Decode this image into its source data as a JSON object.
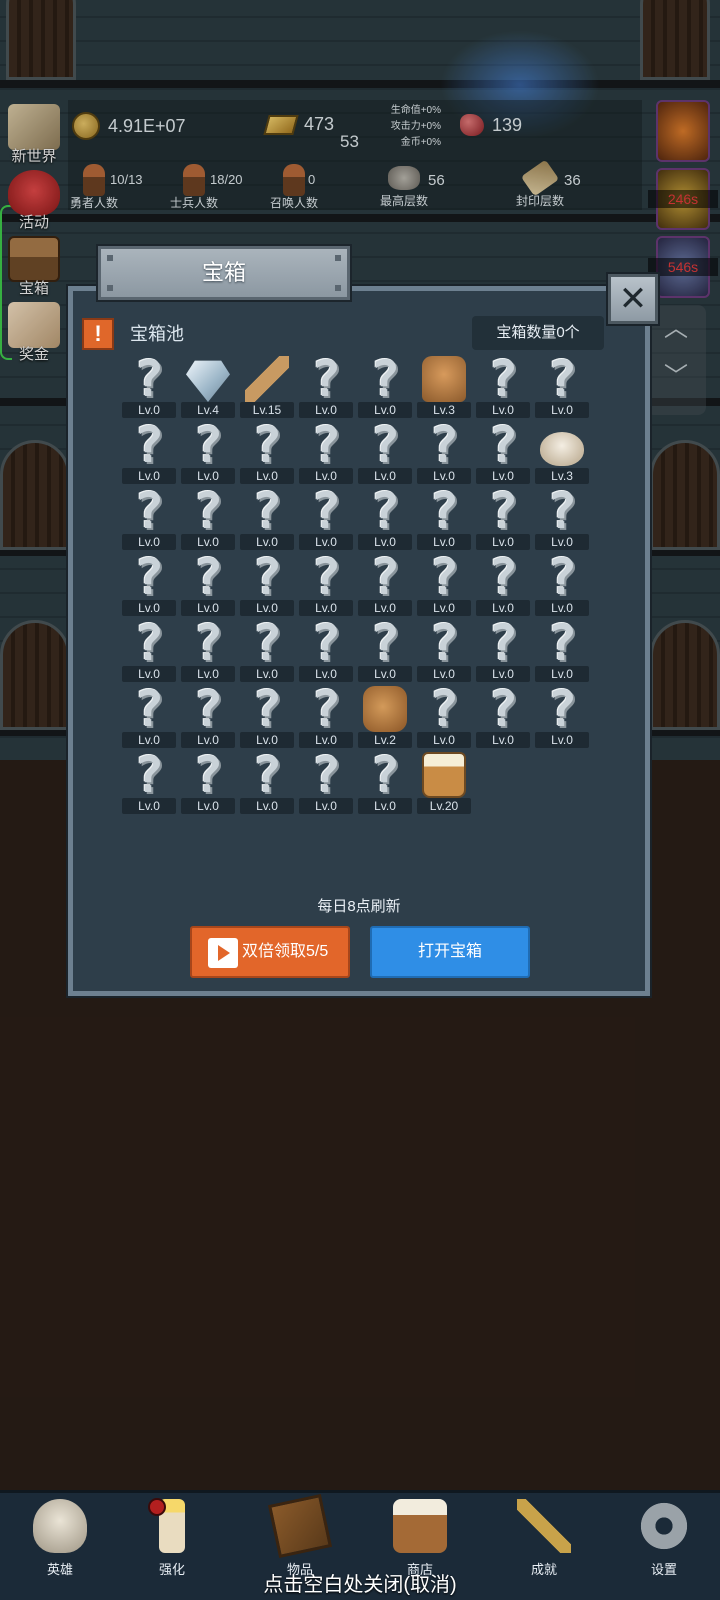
{
  "hud": {
    "gold": "4.91E+07",
    "bars": "473",
    "gems": "139",
    "floor_num": "53",
    "bonuses": [
      "生命值+0%",
      "攻击力+0%",
      "金币+0%"
    ],
    "stats": [
      {
        "label": "勇者人数",
        "value": "10/13"
      },
      {
        "label": "士兵人数",
        "value": "18/20"
      },
      {
        "label": "召唤人数",
        "value": "0"
      },
      {
        "label": "最高层数",
        "value": "56"
      },
      {
        "label": "封印层数",
        "value": "36"
      }
    ]
  },
  "sidebar_left": [
    {
      "label": "新世界",
      "icon": "map-icon"
    },
    {
      "label": "活动",
      "icon": "heart-icon"
    },
    {
      "label": "宝箱",
      "icon": "chest-icon"
    },
    {
      "label": "奖金",
      "icon": "envelope-icon"
    }
  ],
  "sidebar_right": {
    "timers": [
      "246s",
      "546s"
    ]
  },
  "modal": {
    "title": "宝箱",
    "pool_title": "宝箱池",
    "chest_count": "宝箱数量0个",
    "refresh_text": "每日8点刷新",
    "double_button": "双倍领取5/5",
    "open_button": "打开宝箱",
    "items": [
      {
        "icon": "unknown",
        "level": "Lv.0"
      },
      {
        "icon": "diamond",
        "level": "Lv.4"
      },
      {
        "icon": "sword",
        "level": "Lv.15"
      },
      {
        "icon": "unknown",
        "level": "Lv.0"
      },
      {
        "icon": "unknown",
        "level": "Lv.0"
      },
      {
        "icon": "armor",
        "level": "Lv.3"
      },
      {
        "icon": "unknown",
        "level": "Lv.0"
      },
      {
        "icon": "unknown",
        "level": "Lv.0"
      },
      {
        "icon": "unknown",
        "level": "Lv.0"
      },
      {
        "icon": "unknown",
        "level": "Lv.0"
      },
      {
        "icon": "unknown",
        "level": "Lv.0"
      },
      {
        "icon": "unknown",
        "level": "Lv.0"
      },
      {
        "icon": "unknown",
        "level": "Lv.0"
      },
      {
        "icon": "unknown",
        "level": "Lv.0"
      },
      {
        "icon": "unknown",
        "level": "Lv.0"
      },
      {
        "icon": "bread",
        "level": "Lv.3"
      },
      {
        "icon": "unknown",
        "level": "Lv.0"
      },
      {
        "icon": "unknown",
        "level": "Lv.0"
      },
      {
        "icon": "unknown",
        "level": "Lv.0"
      },
      {
        "icon": "unknown",
        "level": "Lv.0"
      },
      {
        "icon": "unknown",
        "level": "Lv.0"
      },
      {
        "icon": "unknown",
        "level": "Lv.0"
      },
      {
        "icon": "unknown",
        "level": "Lv.0"
      },
      {
        "icon": "unknown",
        "level": "Lv.0"
      },
      {
        "icon": "unknown",
        "level": "Lv.0"
      },
      {
        "icon": "unknown",
        "level": "Lv.0"
      },
      {
        "icon": "unknown",
        "level": "Lv.0"
      },
      {
        "icon": "unknown",
        "level": "Lv.0"
      },
      {
        "icon": "unknown",
        "level": "Lv.0"
      },
      {
        "icon": "unknown",
        "level": "Lv.0"
      },
      {
        "icon": "unknown",
        "level": "Lv.0"
      },
      {
        "icon": "unknown",
        "level": "Lv.0"
      },
      {
        "icon": "unknown",
        "level": "Lv.0"
      },
      {
        "icon": "unknown",
        "level": "Lv.0"
      },
      {
        "icon": "unknown",
        "level": "Lv.0"
      },
      {
        "icon": "unknown",
        "level": "Lv.0"
      },
      {
        "icon": "unknown",
        "level": "Lv.0"
      },
      {
        "icon": "unknown",
        "level": "Lv.0"
      },
      {
        "icon": "unknown",
        "level": "Lv.0"
      },
      {
        "icon": "unknown",
        "level": "Lv.0"
      },
      {
        "icon": "unknown",
        "level": "Lv.0"
      },
      {
        "icon": "unknown",
        "level": "Lv.0"
      },
      {
        "icon": "unknown",
        "level": "Lv.0"
      },
      {
        "icon": "unknown",
        "level": "Lv.0"
      },
      {
        "icon": "bag",
        "level": "Lv.2"
      },
      {
        "icon": "unknown",
        "level": "Lv.0"
      },
      {
        "icon": "unknown",
        "level": "Lv.0"
      },
      {
        "icon": "unknown",
        "level": "Lv.0"
      },
      {
        "icon": "unknown",
        "level": "Lv.0"
      },
      {
        "icon": "unknown",
        "level": "Lv.0"
      },
      {
        "icon": "unknown",
        "level": "Lv.0"
      },
      {
        "icon": "unknown",
        "level": "Lv.0"
      },
      {
        "icon": "unknown",
        "level": "Lv.0"
      },
      {
        "icon": "beer",
        "level": "Lv.20"
      }
    ]
  },
  "bottom_nav": [
    {
      "label": "英雄",
      "icon": "skull-icon"
    },
    {
      "label": "强化",
      "icon": "candle-icon"
    },
    {
      "label": "物品",
      "icon": "book-icon"
    },
    {
      "label": "商店",
      "icon": "mug-icon"
    },
    {
      "label": "成就",
      "icon": "key-icon"
    },
    {
      "label": "设置",
      "icon": "gear-icon"
    }
  ],
  "close_hint": "点击空白处关闭(取消)",
  "colors": {
    "panel": "#2e3e4a",
    "orange_button": "#e2662a",
    "blue_button": "#2f8ee6",
    "timer_red": "#e03a3a"
  }
}
